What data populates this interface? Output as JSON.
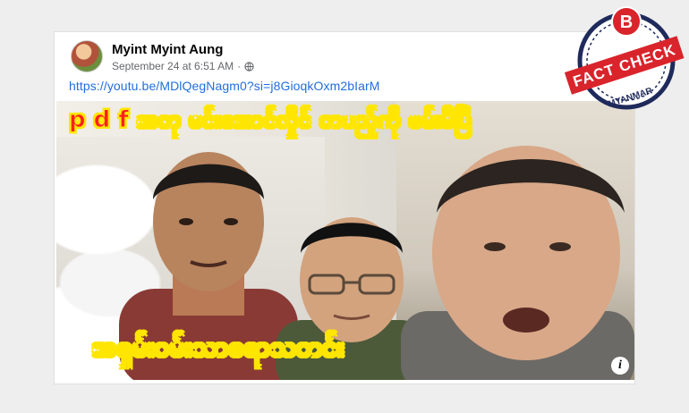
{
  "post": {
    "author": "Myint Myint Aung",
    "timestamp": "September 24 at 6:51 AM",
    "separator": "·",
    "link": "https://youtu.be/MDlQegNagm0?si=j8GioqkOxm2bIarM"
  },
  "thumbnail": {
    "headline_top": "p d f အတု မင်းအောင်လှိုင် တပည့်ကို ဖမ်းမိပြီ",
    "headline_bottom": "အရှမ်းဝမ်းသာစရာသတင်း",
    "info_glyph": "i"
  },
  "badge": {
    "letter": "B",
    "title": "FACT CHECK",
    "subtitle": "MYANMAR",
    "colors": {
      "red": "#d9242b",
      "navy": "#1f2a5c",
      "white": "#ffffff"
    }
  },
  "colors": {
    "link": "#216fdb",
    "headline_text": "#ff1f1f",
    "headline_outline": "#ffe600"
  }
}
